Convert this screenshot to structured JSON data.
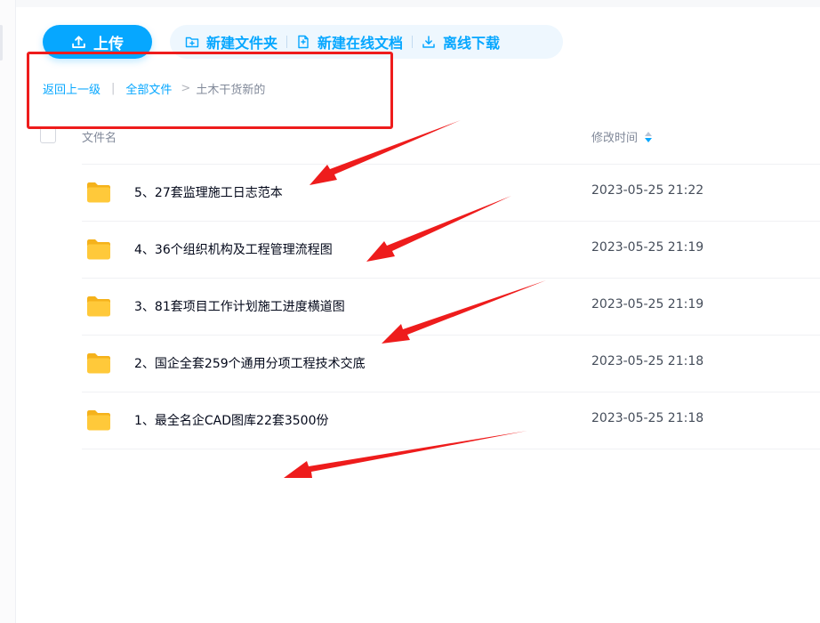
{
  "toolbar": {
    "upload_label": "上传",
    "new_folder_label": "新建文件夹",
    "new_doc_label": "新建在线文档",
    "offline_download_label": "离线下载"
  },
  "breadcrumb": {
    "back_label": "返回上一级",
    "separator": "|",
    "all_files_label": "全部文件",
    "arrow": ">",
    "current_label": "土木干货新的"
  },
  "table": {
    "columns": {
      "name": "文件名",
      "modified": "修改时间"
    },
    "rows": [
      {
        "name": "5、27套监理施工日志范本",
        "time": "2023-05-25 21:22",
        "icon": "folder-icon"
      },
      {
        "name": "4、36个组织机构及工程管理流程图",
        "time": "2023-05-25 21:19",
        "icon": "folder-icon"
      },
      {
        "name": "3、81套项目工作计划施工进度横道图",
        "time": "2023-05-25 21:19",
        "icon": "folder-icon"
      },
      {
        "name": "2、国企全套259个通用分项工程技术交底",
        "time": "2023-05-25 21:18",
        "icon": "folder-icon"
      },
      {
        "name": "1、最全名企CAD图库22套3500份",
        "time": "2023-05-25 21:18",
        "icon": "folder-icon"
      }
    ]
  },
  "colors": {
    "accent": "#06a7ff",
    "annotation_red": "#ee1c1c",
    "folder_yellow": "#ffc93a"
  }
}
